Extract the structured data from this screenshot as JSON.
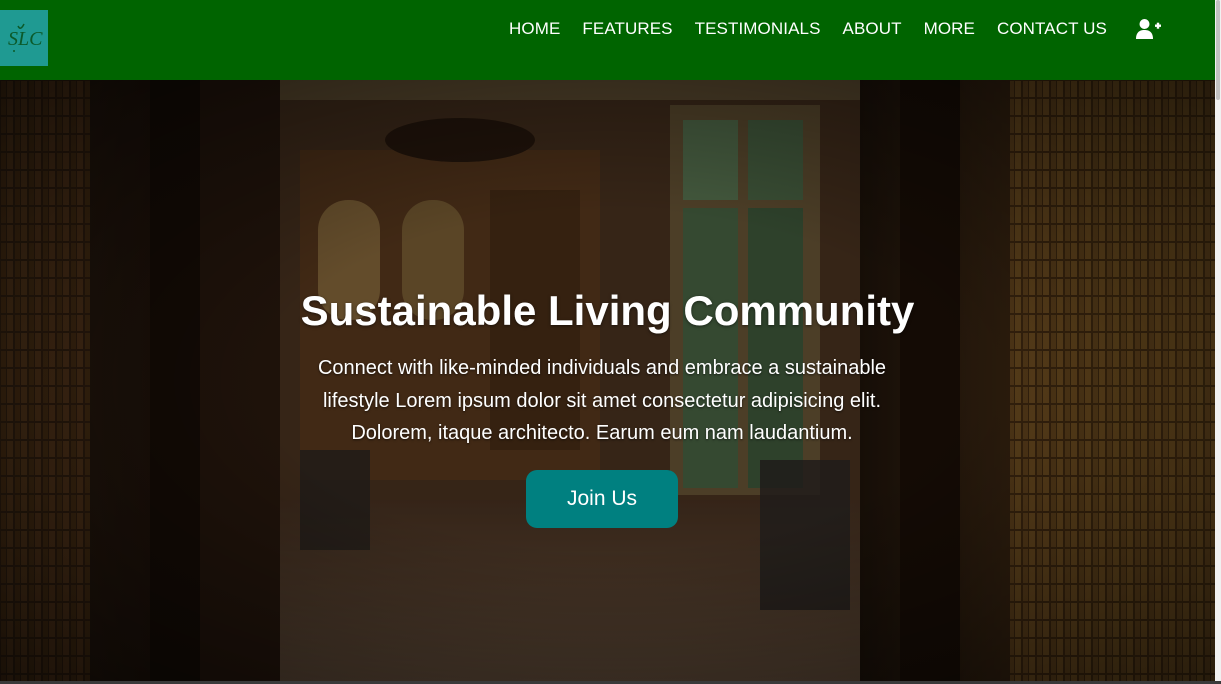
{
  "header": {
    "logo_text": "SLC",
    "nav": [
      {
        "label": "HOME"
      },
      {
        "label": "FEATURES"
      },
      {
        "label": "TESTIMONIALS"
      },
      {
        "label": "ABOUT"
      },
      {
        "label": "MORE"
      },
      {
        "label": "CONTACT US"
      }
    ],
    "user_icon": "user-plus-icon"
  },
  "hero": {
    "title": "Sustainable Living Community",
    "text": "Connect with like-minded individuals and embrace a sustainable lifestyle Lorem ipsum dolor sit amet consectetur adipisicing elit. Dolorem, itaque architecto. Earum eum nam laudantium.",
    "button_label": "Join Us",
    "background_image": "dark wooden library interior"
  },
  "colors": {
    "navbar": "#006400",
    "logo_bg": "#1f9a92",
    "button": "#008080",
    "text": "#ffffff"
  }
}
